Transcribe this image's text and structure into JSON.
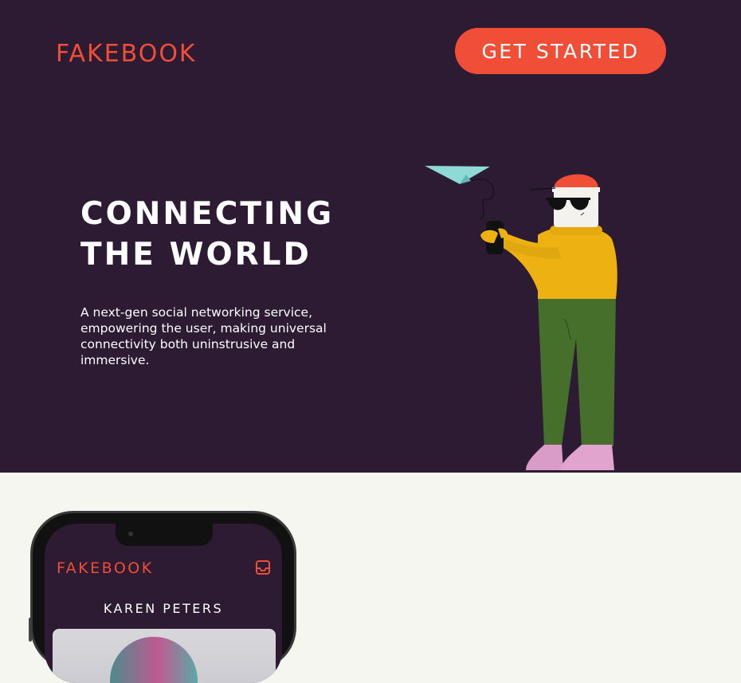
{
  "header": {
    "logo": "FAKEBOOK",
    "cta_label": "GET STARTED"
  },
  "hero": {
    "headline_line1": "CONNECTING",
    "headline_line2": "THE WORLD",
    "description": "A next-gen social networking service, empowering the user, making universal connectivity both uninstrusive and immersive."
  },
  "phone": {
    "logo": "FAKEBOOK",
    "profile_name": "KAREN PETERS",
    "inbox_icon": "inbox-icon"
  },
  "colors": {
    "hero_bg": "#2c1b33",
    "accent": "#f04e37",
    "page_bg": "#f6f6f0"
  }
}
